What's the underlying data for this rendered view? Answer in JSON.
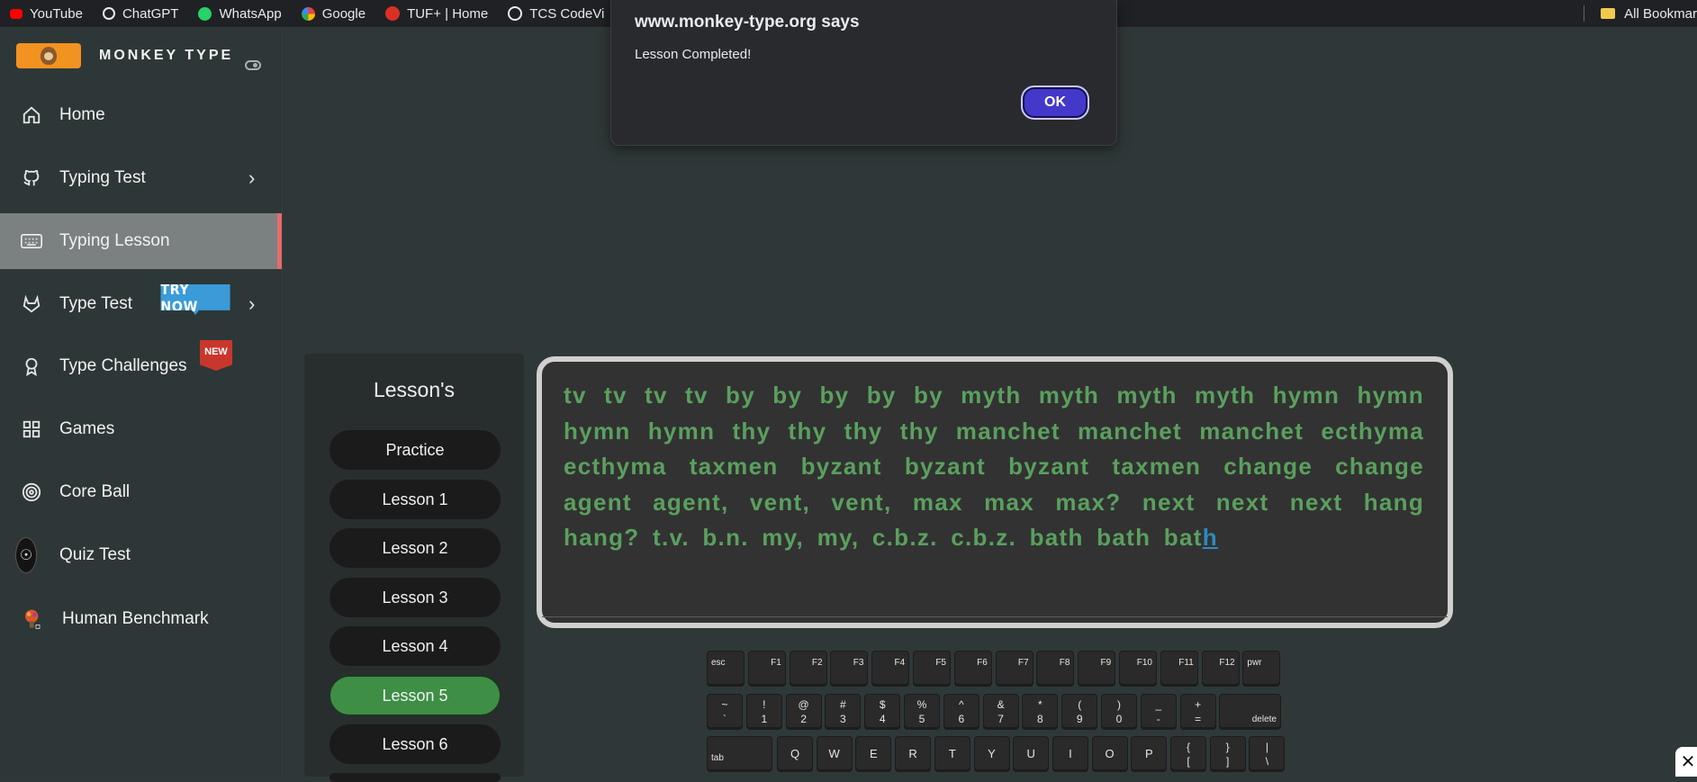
{
  "bookmarks": {
    "items": [
      {
        "label": "YouTube",
        "color": "#ff0000"
      },
      {
        "label": "ChatGPT",
        "color": "#e8eaed"
      },
      {
        "label": "WhatsApp",
        "color": "#25d366"
      },
      {
        "label": "Google",
        "color": "#4285f4"
      },
      {
        "label": "TUF+ | Home",
        "color": "#d93025"
      },
      {
        "label": "TCS CodeVi",
        "color": "#e8eaed"
      }
    ],
    "all_bookmarks": "All Bookmar"
  },
  "sidebar": {
    "brand": "MONKEY TYPE",
    "items": [
      {
        "label": "Home",
        "icon": "home-icon"
      },
      {
        "label": "Typing Test",
        "icon": "github-icon",
        "chevron": "›"
      },
      {
        "label": "Typing Lesson",
        "icon": "keyboard-icon"
      },
      {
        "label": "Type Test",
        "icon": "gitlab-icon",
        "chevron": "›",
        "badge": "TRY NOW"
      },
      {
        "label": "Type Challenges",
        "icon": "award-icon",
        "badge": "NEW"
      },
      {
        "label": "Games",
        "icon": "grid-icon"
      },
      {
        "label": "Core Ball",
        "icon": "target-icon"
      },
      {
        "label": "Quiz Test",
        "icon": "brain-avatar-icon"
      },
      {
        "label": "Human Benchmark",
        "icon": "brain-person-icon"
      }
    ]
  },
  "dialog": {
    "title": "www.monkey-type.org says",
    "message": "Lesson Completed!",
    "ok": "OK"
  },
  "lessons": {
    "title": "Lesson's",
    "items": [
      "Practice",
      "Lesson 1",
      "Lesson 2",
      "Lesson 3",
      "Lesson 4",
      "Lesson 5",
      "Lesson 6"
    ],
    "active": "Lesson 5"
  },
  "typing": {
    "typed": "tv tv tv tv by by by by by myth myth myth myth hymn hymn hymn hymn thy thy thy thy manchet manchet manchet ecthyma ecthyma taxmen byzant byzant byzant taxmen change change agent agent, vent, vent, max max max? next next next hang hang? t.v. b.n. my, my, c.b.z. c.b.z. bath bath bat",
    "current": "h"
  },
  "keyboard": {
    "row1": [
      "esc",
      "F1",
      "F2",
      "F3",
      "F4",
      "F5",
      "F6",
      "F7",
      "F8",
      "F9",
      "F10",
      "F11",
      "F12",
      "pwr"
    ],
    "row2": [
      {
        "top": "~",
        "bottom": "`"
      },
      {
        "top": "!",
        "bottom": "1"
      },
      {
        "top": "@",
        "bottom": "2"
      },
      {
        "top": "#",
        "bottom": "3"
      },
      {
        "top": "$",
        "bottom": "4"
      },
      {
        "top": "%",
        "bottom": "5"
      },
      {
        "top": "^",
        "bottom": "6"
      },
      {
        "top": "&",
        "bottom": "7"
      },
      {
        "top": "*",
        "bottom": "8"
      },
      {
        "top": "(",
        "bottom": "9"
      },
      {
        "top": ")",
        "bottom": "0"
      },
      {
        "top": "_",
        "bottom": "-"
      },
      {
        "top": "+",
        "bottom": "="
      }
    ],
    "delete": "delete",
    "tab": "tab",
    "row3": [
      "Q",
      "W",
      "E",
      "R",
      "T",
      "Y",
      "U",
      "I",
      "O",
      "P"
    ],
    "row3_symbols": [
      {
        "top": "{",
        "bottom": "["
      },
      {
        "top": "}",
        "bottom": "]"
      },
      {
        "top": "|",
        "bottom": "\\"
      }
    ]
  },
  "close_glyph": "✕"
}
